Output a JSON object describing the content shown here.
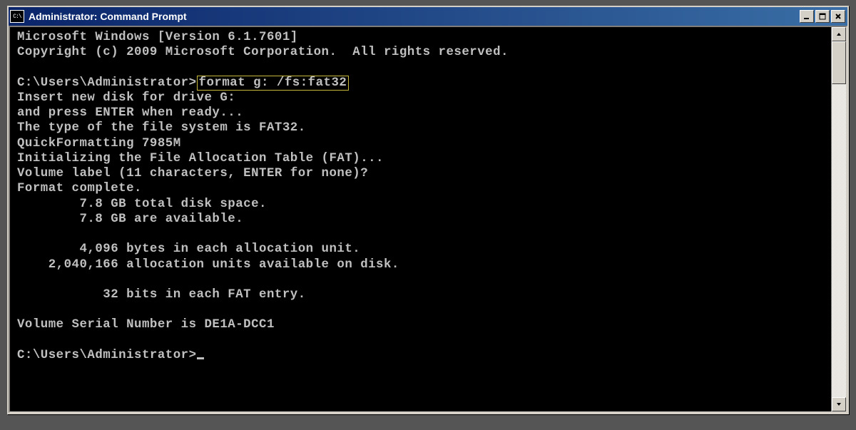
{
  "window": {
    "title": "Administrator: Command Prompt",
    "icon_label": "C:\\"
  },
  "terminal": {
    "line1": "Microsoft Windows [Version 6.1.7601]",
    "line2": "Copyright (c) 2009 Microsoft Corporation.  All rights reserved.",
    "blank1": "",
    "prompt1_prefix": "C:\\Users\\Administrator>",
    "command_highlight": "format g: /fs:fat32",
    "out1": "Insert new disk for drive G:",
    "out2": "and press ENTER when ready...",
    "out3": "The type of the file system is FAT32.",
    "out4": "QuickFormatting 7985M",
    "out5": "Initializing the File Allocation Table (FAT)...",
    "out6": "Volume label (11 characters, ENTER for none)?",
    "out7": "Format complete.",
    "out8": "        7.8 GB total disk space.",
    "out9": "        7.8 GB are available.",
    "blank2": "",
    "out10": "        4,096 bytes in each allocation unit.",
    "out11": "    2,040,166 allocation units available on disk.",
    "blank3": "",
    "out12": "           32 bits in each FAT entry.",
    "blank4": "",
    "out13": "Volume Serial Number is DE1A-DCC1",
    "blank5": "",
    "prompt2": "C:\\Users\\Administrator>"
  }
}
